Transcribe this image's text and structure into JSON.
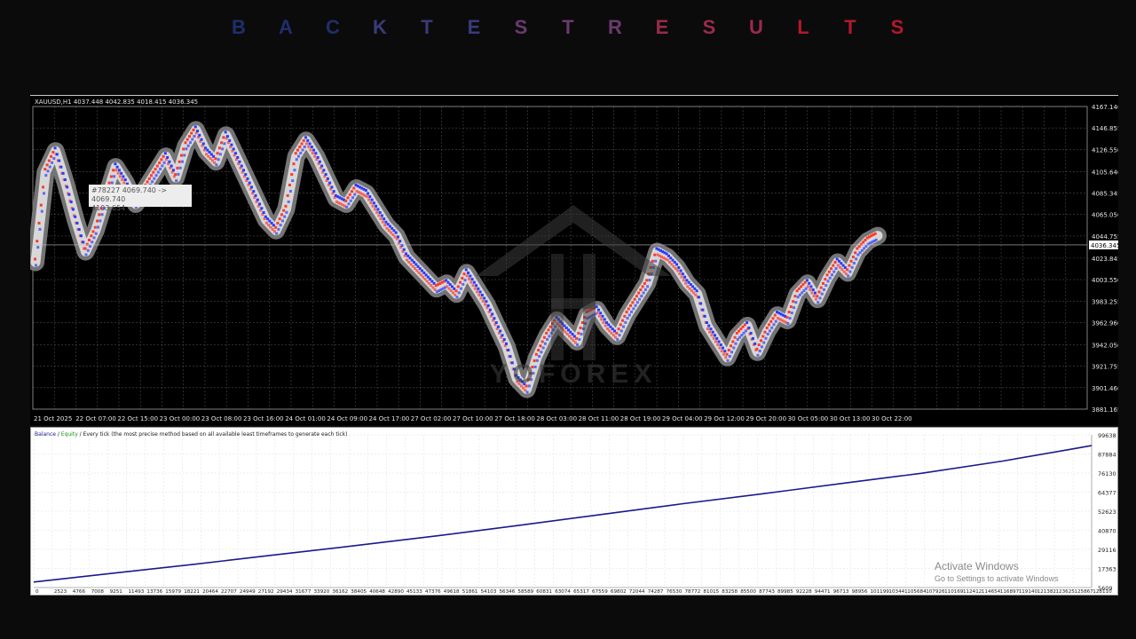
{
  "title": "BACKTESTRESULTS",
  "colors": {
    "title_gradient": [
      "#1f2f6b",
      "#3a3a7a",
      "#6a3a6e",
      "#9a2a4a",
      "#b2182b"
    ],
    "price_bg": "#000000",
    "grid": "#4a4a4a",
    "equity_line": "#1a1a8a",
    "buy_marker": "#2a3bff",
    "sell_marker": "#ff3a2a"
  },
  "price_panel": {
    "symbol_header": "XAUUSD,H1  4037.448 4042.835 4018.415 4036.345",
    "tooltip_line1": "#78227 4069.740 -> 4069.740",
    "tooltip_line2": "4103.654",
    "current_price_label": "4036.345"
  },
  "equity_panel": {
    "legend_balance": "Balance",
    "legend_sep1": " / ",
    "legend_equity": "Equity",
    "legend_rest": " / Every tick (the most precise method based on all available least timeframes to generate each tick)"
  },
  "watermark": {
    "line1": "Activate Windows",
    "line2": "Go to Settings to activate Windows"
  },
  "logo_text": "YOFOREX",
  "chart_data": [
    {
      "type": "line",
      "title": "",
      "xlabel": "",
      "ylabel": "",
      "ylim": [
        3881.165,
        4167.14
      ],
      "y_ticks": [
        "4167.140",
        "4146.855",
        "4126.550",
        "4105.640",
        "4085.345",
        "4065.050",
        "4044.755",
        "4023.845",
        "4003.550",
        "3983.255",
        "3962.960",
        "3942.050",
        "3921.755",
        "3901.460",
        "3881.165"
      ],
      "x_ticks": [
        "21 Oct 2025",
        "22 Oct 07:00",
        "22 Oct 15:00",
        "23 Oct 00:00",
        "23 Oct 08:00",
        "23 Oct 16:00",
        "24 Oct 01:00",
        "24 Oct 09:00",
        "24 Oct 17:00",
        "27 Oct 02:00",
        "27 Oct 10:00",
        "27 Oct 18:00",
        "28 Oct 03:00",
        "28 Oct 11:00",
        "28 Oct 19:00",
        "29 Oct 04:00",
        "29 Oct 12:00",
        "29 Oct 20:00",
        "30 Oct 05:00",
        "30 Oct 13:00",
        "30 Oct 22:00"
      ],
      "grid": true,
      "series": [
        {
          "values": [
            4020,
            4105,
            4125,
            4095,
            4060,
            4030,
            4050,
            4080,
            4110,
            4095,
            4075,
            4090,
            4105,
            4120,
            4100,
            4130,
            4145,
            4125,
            4115,
            4140,
            4120,
            4100,
            4080,
            4060,
            4050,
            4070,
            4120,
            4135,
            4120,
            4100,
            4080,
            4075,
            4090,
            4085,
            4070,
            4055,
            4045,
            4025,
            4015,
            4005,
            3995,
            4000,
            3990,
            4010,
            3995,
            3980,
            3960,
            3940,
            3910,
            3900,
            3930,
            3950,
            3965,
            3955,
            3945,
            3970,
            3975,
            3960,
            3950,
            3970,
            3985,
            4000,
            4030,
            4025,
            4015,
            4000,
            3990,
            3960,
            3945,
            3930,
            3950,
            3960,
            3935,
            3955,
            3970,
            3965,
            3990,
            4000,
            3985,
            4005,
            4020,
            4010,
            4030,
            4040,
            4045
          ]
        }
      ]
    },
    {
      "type": "line",
      "title": "",
      "xlabel": "",
      "ylabel": "",
      "ylim": [
        5609,
        99638
      ],
      "y_ticks": [
        "99638",
        "87884",
        "76130",
        "64377",
        "52623",
        "40870",
        "29116",
        "17363",
        "5609"
      ],
      "x_ticks": [
        "0",
        "2523",
        "4766",
        "7008",
        "9251",
        "11493",
        "13736",
        "15979",
        "18221",
        "20464",
        "22707",
        "24949",
        "27192",
        "29434",
        "31677",
        "33920",
        "36162",
        "38405",
        "40648",
        "42890",
        "45133",
        "47376",
        "49618",
        "51861",
        "54103",
        "56346",
        "58589",
        "60831",
        "63074",
        "65317",
        "67559",
        "69802",
        "72044",
        "74287",
        "76530",
        "78772",
        "81015",
        "83258",
        "85500",
        "87743",
        "89985",
        "92228",
        "94471",
        "96713",
        "98956",
        "101199",
        "103441",
        "105684",
        "107926",
        "110169",
        "112412",
        "114654",
        "116897",
        "119140",
        "121382",
        "123625",
        "125867",
        "128110"
      ],
      "grid": true,
      "series": [
        {
          "name": "Balance",
          "x": [
            0,
            10000,
            20000,
            30000,
            40000,
            50000,
            60000,
            70000,
            80000,
            90000,
            100000,
            110000,
            120000,
            128110,
            131000
          ],
          "values": [
            9000,
            14500,
            20000,
            25800,
            31500,
            37500,
            43800,
            50400,
            57000,
            63200,
            69700,
            76000,
            83500,
            90500,
            93000
          ]
        }
      ]
    }
  ]
}
